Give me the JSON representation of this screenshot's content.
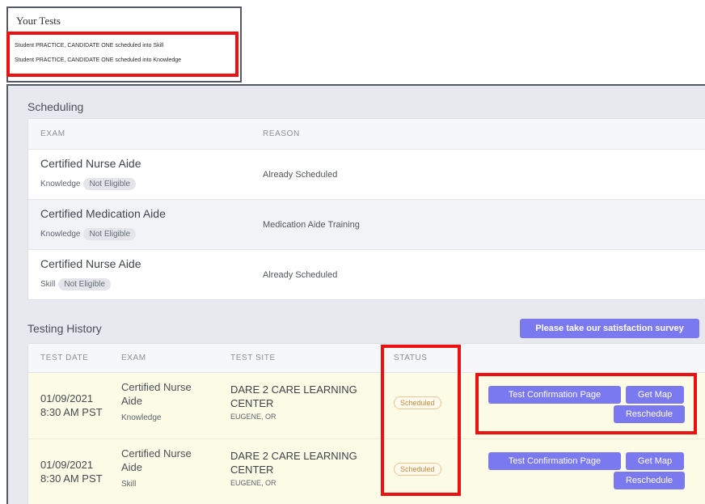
{
  "your_tests": {
    "title": "Your Tests",
    "items": [
      "Student PRACTICE, CANDIDATE ONE scheduled into Skill",
      "Student PRACTICE, CANDIDATE ONE scheduled into Knowledge"
    ]
  },
  "scheduling": {
    "title": "Scheduling",
    "columns": {
      "exam": "EXAM",
      "reason": "REASON"
    },
    "rows": [
      {
        "exam": "Certified Nurse Aide",
        "type": "Knowledge",
        "badge": "Not Eligible",
        "reason": "Already Scheduled"
      },
      {
        "exam": "Certified Medication Aide",
        "type": "Knowledge",
        "badge": "Not Eligible",
        "reason": "Medication Aide Training"
      },
      {
        "exam": "Certified Nurse Aide",
        "type": "Skill",
        "badge": "Not Eligible",
        "reason": "Already Scheduled"
      }
    ]
  },
  "testing_history": {
    "title": "Testing History",
    "survey_button": "Please take our satisfaction survey",
    "columns": {
      "test_date": "TEST DATE",
      "exam": "EXAM",
      "test_site": "TEST SITE",
      "status": "STATUS"
    },
    "rows": [
      {
        "date": "01/09/2021",
        "time": "8:30 AM PST",
        "exam_line1": "Certified Nurse",
        "exam_line2": "Aide",
        "type": "Knowledge",
        "site_line1": "DARE 2 CARE LEARNING",
        "site_line2": "CENTER",
        "location": "EUGENE, OR",
        "status": "Scheduled",
        "btn_confirm": "Test Confirmation Page",
        "btn_map": "Get Map",
        "btn_reschedule": "Reschedule"
      },
      {
        "date": "01/09/2021",
        "time": "8:30 AM PST",
        "exam_line1": "Certified Nurse",
        "exam_line2": "Aide",
        "type": "Skill",
        "site_line1": "DARE 2 CARE LEARNING",
        "site_line2": "CENTER",
        "location": "EUGENE, OR",
        "status": "Scheduled",
        "btn_confirm": "Test Confirmation Page",
        "btn_map": "Get Map",
        "btn_reschedule": "Reschedule"
      }
    ]
  },
  "colors": {
    "accent": "#7b79f0",
    "highlight": "#ec1010",
    "status": "#c98a38",
    "row_highlight": "#fbfbe6"
  }
}
